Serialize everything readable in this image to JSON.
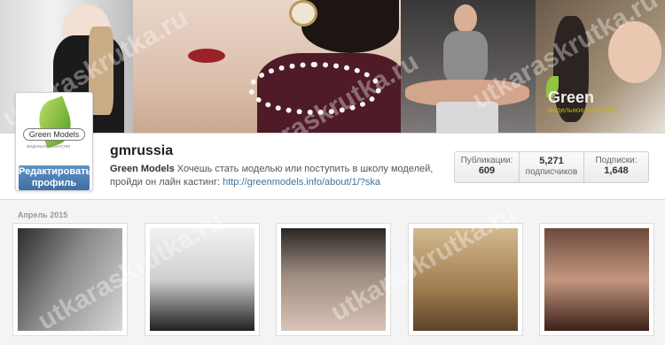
{
  "profile": {
    "username": "gmrussia",
    "edit_button": "Редактировать профиль",
    "bio_name": "Green Models",
    "bio_text": " Хочешь стать моделью или поступить в школу моделей, пройди он лайн кастинг: ",
    "bio_link": "http://greenmodels.info/about/1/?ska"
  },
  "avatar": {
    "logo_text": "Green Models",
    "logo_subtext": "модельное агентство"
  },
  "cover": {
    "logo_text": "Green",
    "logo_subtext": "модельное агентство"
  },
  "stats": [
    {
      "label": "Публикации:",
      "value": "609"
    },
    {
      "label": "подписчиков",
      "value": "5,271"
    },
    {
      "label": "Подписки:",
      "value": "1,648"
    }
  ],
  "feed": {
    "section_label": "Апрель 2015"
  },
  "watermark": "utkaraskrutka.ru",
  "colors": {
    "link": "#3f729b",
    "edit_button": "#4a7db4",
    "accent_green": "#7ab531"
  }
}
